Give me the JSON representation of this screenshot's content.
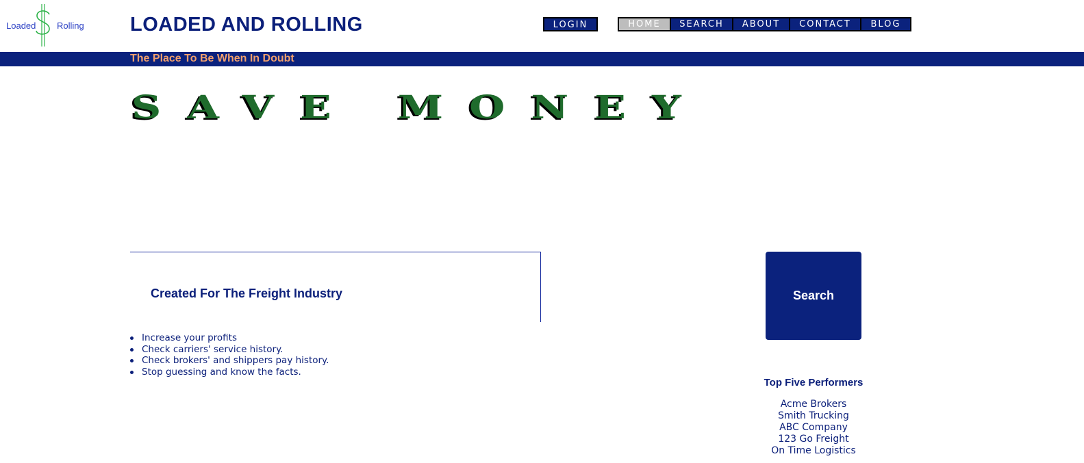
{
  "logo": {
    "left_word": "Loaded",
    "right_word": "Rolling"
  },
  "header": {
    "title": "LOADED AND ROLLING",
    "tagline": "The Place To Be When In Doubt"
  },
  "nav": {
    "login": "LOGIN",
    "items": [
      {
        "label": "HOME",
        "active": true
      },
      {
        "label": "SEARCH",
        "active": false
      },
      {
        "label": "ABOUT",
        "active": false
      },
      {
        "label": "CONTACT",
        "active": false
      },
      {
        "label": "BLOG",
        "active": false
      }
    ]
  },
  "hero": {
    "text": "SAVE MONEY"
  },
  "intro": {
    "heading": "Created For The Freight Industry",
    "benefits": [
      "Increase your profits",
      "Check carriers' service history.",
      "Check brokers' and shippers pay history.",
      "Stop guessing and know the facts."
    ]
  },
  "sidebar": {
    "search_label": "Search",
    "performers_title": "Top Five Performers",
    "performers": [
      "Acme Brokers",
      "Smith Trucking",
      "ABC Company",
      "123 Go Freight",
      "On Time Logistics"
    ]
  },
  "colors": {
    "brand_navy": "#0b227d",
    "tagline_orange": "#f3a06d",
    "hero_green": "#1f6b2c",
    "active_nav_gray": "#bdbdbd",
    "logo_dollar_green": "#2fb34a"
  },
  "icons": {
    "logo_symbol": "dollar-sign-logo-icon",
    "bullet": "bullet-dot-icon"
  }
}
